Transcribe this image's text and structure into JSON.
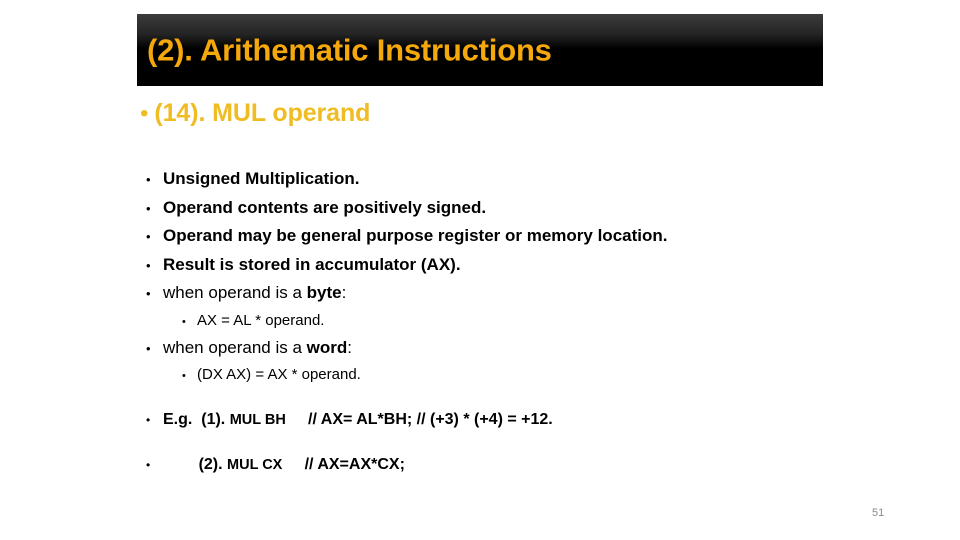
{
  "slide": {
    "background_color": "#ffffff",
    "title": {
      "text": "(2). Arithematic Instructions",
      "color": "#F5A80B",
      "banner_color_top": "#3c3c3c",
      "banner_color_bottom": "#000000"
    },
    "subtitle": {
      "bullet": "•",
      "text": "(14). MUL operand",
      "color": "#EFBC23"
    },
    "bullets": [
      {
        "bullet": "•",
        "text": "Unsigned Multiplication.",
        "level": 1,
        "weight": "bold"
      },
      {
        "bullet": "•",
        "text": "Operand contents are positively signed.",
        "level": 1,
        "weight": "bold"
      },
      {
        "bullet": "•",
        "text": "Operand may be general purpose register or memory location.",
        "level": 1,
        "weight": "bold"
      },
      {
        "bullet": "•",
        "text": "Result is stored in accumulator (AX).",
        "level": 1,
        "weight": "bold"
      },
      {
        "bullet": "•",
        "text_prefix": "when operand is a ",
        "text_bold": "byte",
        "text_suffix": ":",
        "level": 1,
        "weight": "normal"
      },
      {
        "bullet": "•",
        "text": "AX = AL * operand.",
        "level": 2,
        "weight": "normal"
      },
      {
        "bullet": "•",
        "text_prefix": "when operand is a ",
        "text_bold": "word",
        "text_suffix": ":",
        "level": 1,
        "weight": "normal"
      },
      {
        "bullet": "•",
        "text": "(DX AX) = AX * operand.",
        "level": 2,
        "weight": "normal"
      }
    ],
    "examples": [
      {
        "bullet": "•",
        "label": "E.g.  ",
        "number": "(1). ",
        "instruction": "MUL BH",
        "gap": "     ",
        "comment": "// AX= AL*BH; // (+3) * (+4) = +12."
      },
      {
        "bullet": "•",
        "label": "        ",
        "number": "(2). ",
        "instruction": "MUL CX",
        "gap": "     ",
        "comment": "// AX=AX*CX;"
      }
    ],
    "page_number": "51"
  }
}
